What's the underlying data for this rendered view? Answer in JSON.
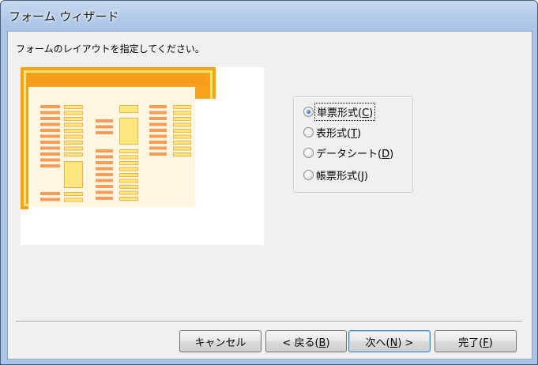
{
  "window": {
    "title": "フォーム ウィザード"
  },
  "instruction": "フォームのレイアウトを指定してください。",
  "options": [
    {
      "label": "単票形式(",
      "mnemonic": "C",
      "suffix": ")",
      "checked": true,
      "focused": true
    },
    {
      "label": "表形式(",
      "mnemonic": "T",
      "suffix": ")",
      "checked": false,
      "focused": false
    },
    {
      "label": "データシート(",
      "mnemonic": "D",
      "suffix": ")",
      "checked": false,
      "focused": false
    },
    {
      "label": "帳票形式(",
      "mnemonic": "J",
      "suffix": ")",
      "checked": false,
      "focused": false
    }
  ],
  "buttons": {
    "cancel": {
      "label": "キャンセル"
    },
    "back": {
      "label": "< 戻る(",
      "mnemonic": "B",
      "suffix": ")"
    },
    "next": {
      "label": "次へ(",
      "mnemonic": "N",
      "suffix": ") >"
    },
    "finish": {
      "label": "完了(",
      "mnemonic": "F",
      "suffix": ")"
    }
  },
  "colors": {
    "accent_orange": "#f7a21b",
    "label_orange": "#f59d56",
    "field_yellow": "#fee77e",
    "preview_bg": "#fff6e2"
  }
}
